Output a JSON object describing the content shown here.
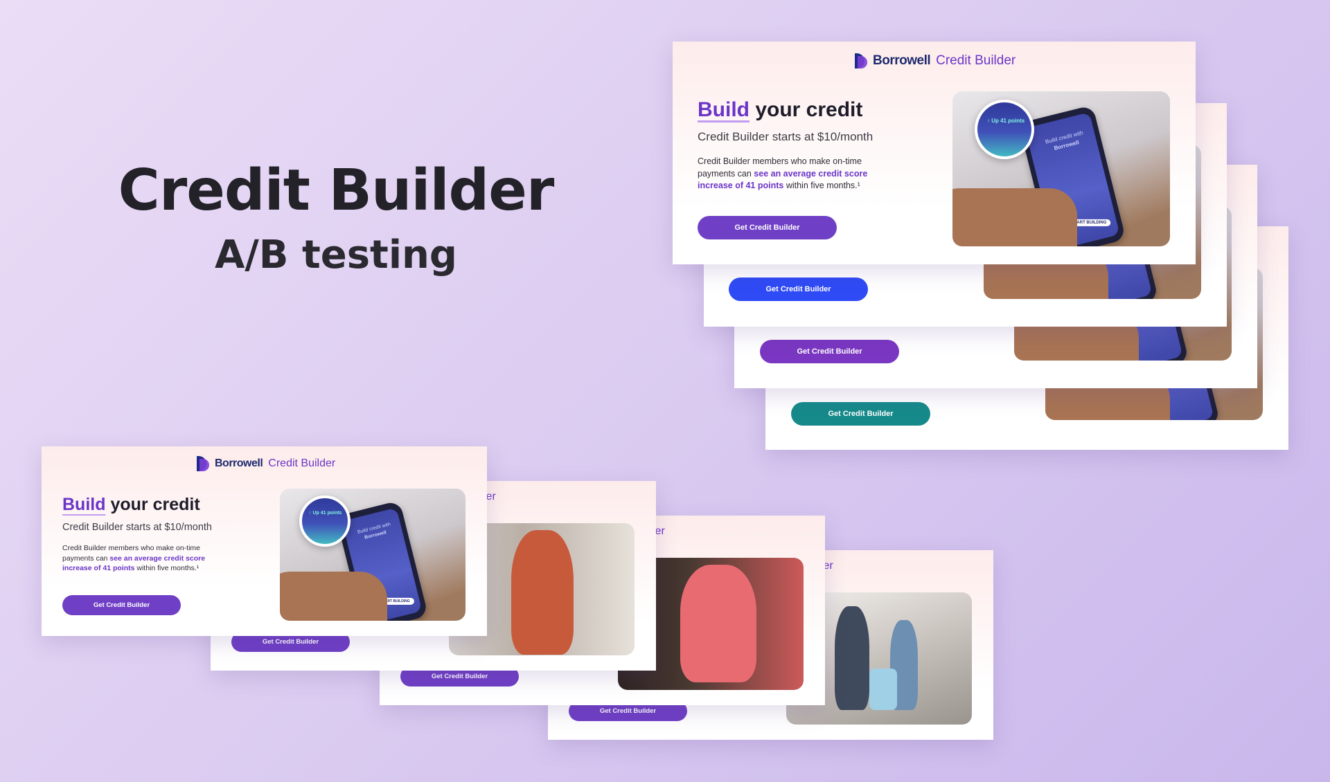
{
  "hero": {
    "title": "Credit Builder",
    "subtitle": "A/B testing"
  },
  "brand": {
    "name": "Borrowell",
    "product": "Credit Builder"
  },
  "ad": {
    "headline_accent": "Build",
    "headline_rest": " your credit",
    "subhead": "Credit Builder starts at $10/month",
    "body_prefix": "Credit Builder members who make on-time payments can ",
    "body_link": "see an average credit score increase of 41 points",
    "body_suffix": " within five months.¹",
    "cta": "Get Credit Builder"
  },
  "phone_art": {
    "zoom_label": "↑ Up 41 points",
    "screen_text": "Build credit with",
    "screen_brand": "Borrowell",
    "screen_button": "START BUILDING"
  },
  "partial_brand_fragment": "ler",
  "button_variants": [
    {
      "label": "Get Credit Builder",
      "color": "#6f3fc6"
    },
    {
      "label": "Get Credit Builder",
      "color": "#2f4bf5"
    },
    {
      "label": "Get Credit Builder",
      "color": "#7a37c2"
    },
    {
      "label": "Get Credit Builder",
      "color": "#168a8a"
    }
  ],
  "image_variants": [
    "phone-in-hand",
    "woman-in-hijab",
    "woman-with-phone",
    "family-with-suitcase"
  ],
  "colors": {
    "brand_purple": "#6b35c8",
    "brand_navy": "#1e2a6e",
    "background": "#dccdf1"
  }
}
